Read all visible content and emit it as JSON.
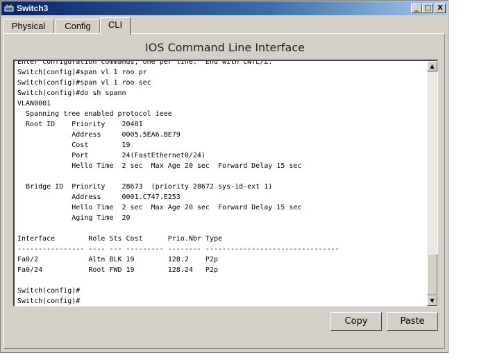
{
  "window": {
    "title": "Switch3",
    "minimize_glyph": "_",
    "maximize_glyph": "□",
    "close_glyph": "X"
  },
  "tabs": [
    {
      "label": "Physical"
    },
    {
      "label": "Config"
    },
    {
      "label": "CLI"
    }
  ],
  "active_tab": "CLI",
  "panel": {
    "title": "IOS Command Line Interface"
  },
  "console": {
    "lines": [
      "Enter configuration commands, one per line.  End with CNTL/Z.",
      "Switch(config)#span vl 1 roo pr",
      "Switch(config)#span vl 1 roo sec",
      "Switch(config)#do sh spann",
      "VLAN0001",
      "  Spanning tree enabled protocol ieee",
      "  Root ID    Priority    20481",
      "             Address     0005.5EA6.BE79",
      "             Cost        19",
      "             Port        24(FastEthernet0/24)",
      "             Hello Time  2 sec  Max Age 20 sec  Forward Delay 15 sec",
      "",
      "  Bridge ID  Priority    28673  (priority 28672 sys-id-ext 1)",
      "             Address     0001.C747.E253",
      "             Hello Time  2 sec  Max Age 20 sec  Forward Delay 15 sec",
      "             Aging Time  20",
      "",
      "Interface        Role Sts Cost      Prio.Nbr Type",
      "---------------- ---- --- --------- -------- --------------------------------",
      "Fa0/2            Altn BLK 19        128.2    P2p",
      "Fa0/24           Root FWD 19        128.24   P2p",
      "",
      "Switch(config)#",
      "Switch(config)#"
    ]
  },
  "scrollbar": {
    "up_glyph": "▲",
    "down_glyph": "▼"
  },
  "buttons": {
    "copy": "Copy",
    "paste": "Paste"
  }
}
